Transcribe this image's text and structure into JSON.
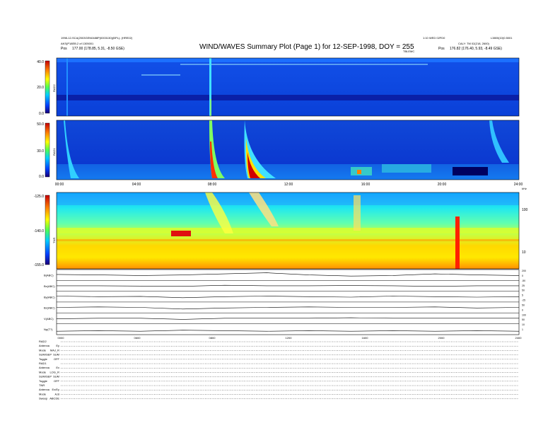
{
  "header": {
    "title": "WIND/WAVES Summary Plot (Page 1) for 12-SEP-1998, DOY = 255",
    "left_line1": "1998-12-SCA(2003GEN0488P(0003130)(BPL)- (HRE02)",
    "left_line2": "AKS(P18EB.2 of 1305001",
    "left_pos": "177.00 (178.85, 5.31, -8.50 GSE)",
    "right_line1": "1:10 WED 02FD0",
    "right_line2": "CALY: TM 02(218, 2600)",
    "right_pos": "176.82 (176.40, 5.93, -8.49 GSE)",
    "right_id": "L3800(10)0.5001",
    "pos_label": "Pos",
    "center_small": "TBLEMC"
  },
  "chart_data": [
    {
      "type": "heatmap",
      "name": "RAD2",
      "ylabel": "RAD2",
      "ylim": [
        0,
        40
      ],
      "yticks": [
        "40.0",
        "20.0",
        "0.0"
      ],
      "colorscale": [
        "#1a007a",
        "#0040ff",
        "#00d0ff",
        "#50ff50",
        "#ffff00",
        "#ff8000",
        "#c80000"
      ]
    },
    {
      "type": "heatmap",
      "name": "RAD1",
      "ylabel": "RAD1",
      "ylim": [
        0,
        50
      ],
      "yticks": [
        "50.0",
        "30.0",
        "0.0"
      ],
      "xticks": [
        "00:00",
        "04:00",
        "08:00",
        "12:00",
        "16:00",
        "20:00",
        "24:00"
      ],
      "colorscale": [
        "#1a007a",
        "#0040ff",
        "#00d0ff",
        "#50ff50",
        "#ffff00",
        "#ff8000",
        "#c80000"
      ]
    },
    {
      "type": "heatmap",
      "name": "TNR",
      "ylabel": "TNR",
      "yticks": [
        "-125.0",
        "-140.0",
        "-155.0"
      ],
      "right_ticks": [
        "100",
        "10"
      ],
      "unit": "kHz",
      "colorscale": [
        "#1a007a",
        "#0040ff",
        "#00d0ff",
        "#50ff50",
        "#ffff00",
        "#ff8000",
        "#c80000"
      ]
    },
    {
      "type": "line",
      "name": "MFI and SWE traces",
      "series": [
        {
          "name": "B(ABC)",
          "values": [
            0.55,
            0.5,
            0.45,
            0.5,
            0.6,
            0.7,
            0.5,
            0.4,
            0.45,
            0.6,
            0.5,
            0.45
          ]
        },
        {
          "name": "Bx(ABC)",
          "values": [
            0.5,
            0.5,
            0.48,
            0.45,
            0.55,
            0.5,
            0.5,
            0.52,
            0.5,
            0.45,
            0.5,
            0.5
          ]
        },
        {
          "name": "By(ABC)",
          "values": [
            0.55,
            0.5,
            0.52,
            0.4,
            0.5,
            0.55,
            0.5,
            0.45,
            0.55,
            0.5,
            0.45,
            0.5
          ]
        },
        {
          "name": "Bz(ABC)",
          "values": [
            0.5,
            0.55,
            0.5,
            0.35,
            0.45,
            0.5,
            0.55,
            0.5,
            0.5,
            0.55,
            0.45,
            0.5
          ]
        },
        {
          "name": "V(ABC)",
          "values": [
            0.45,
            0.5,
            0.5,
            0.4,
            0.5,
            0.5,
            0.5,
            0.55,
            0.5,
            0.5,
            0.5,
            0.5
          ]
        },
        {
          "name": "Np(T?)",
          "values": [
            0.3,
            0.35,
            0.3,
            0.4,
            0.35,
            0.3,
            0.35,
            0.3,
            0.35,
            0.3,
            0.35,
            0.3
          ]
        }
      ],
      "right_ticks": [
        "200",
        "0",
        "-50",
        "25",
        "50",
        "5",
        "-25",
        "50",
        "0",
        "100",
        "50",
        "10",
        "1"
      ],
      "xticks": [
        "0000",
        "0600",
        "0800",
        "1200",
        "1600",
        "2000",
        "2400"
      ]
    }
  ],
  "modes": [
    {
      "label": "RAD2",
      "value": ""
    },
    {
      "label": "Antenna",
      "value": "Ey"
    },
    {
      "label": "Mode",
      "value": "MAJ_R"
    },
    {
      "label": "SUM/SEP",
      "value": "SUM"
    },
    {
      "label": "Toggle",
      "value": "OFF"
    },
    {
      "label": "RAD1",
      "value": ""
    },
    {
      "label": "Antenna",
      "value": "Ex"
    },
    {
      "label": "Mode",
      "value": "LOG_R"
    },
    {
      "label": "SUM/SEP",
      "value": "SUM"
    },
    {
      "label": "Toggle",
      "value": "OFF"
    },
    {
      "label": "TNR",
      "value": ""
    },
    {
      "label": "Antenna",
      "value": "Ex/Ey"
    },
    {
      "label": "Mode",
      "value": "A,B"
    },
    {
      "label": "Sweep",
      "value": "ABCDE"
    }
  ]
}
